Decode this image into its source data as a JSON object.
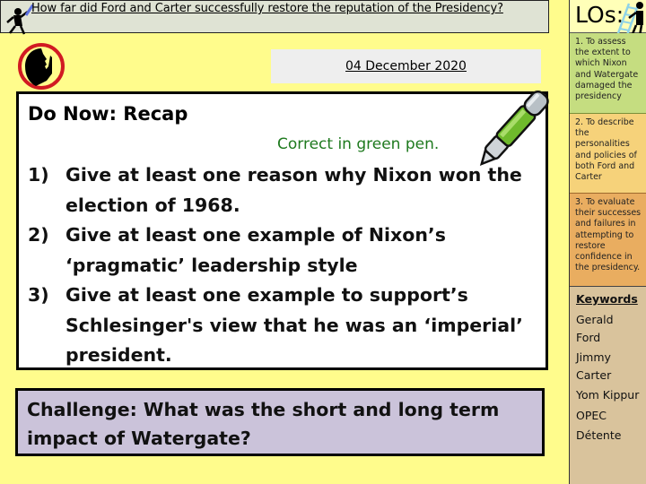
{
  "header": {
    "title": "How far did Ford and Carter successfully restore the reputation of the Presidency?",
    "icon": "running-figure-with-quill-icon"
  },
  "date": "04 December 2020",
  "do_now": {
    "icon": "silence-shush-icon",
    "heading": "Do Now: Recap",
    "note": "Correct in green pen.",
    "note_color": "#1f7a1f",
    "questions": [
      {
        "num": "1)",
        "text": "Give at least one reason why Nixon won the election of 1968."
      },
      {
        "num": "2)",
        "text": "Give at least one example of Nixon’s ‘pragmatic’ leadership style"
      },
      {
        "num": "3)",
        "text": "Give at least one example to support’s Schlesinger's view that he was an ‘imperial’ president."
      }
    ]
  },
  "challenge": {
    "text": "Challenge: What was the short and long term impact of Watergate?"
  },
  "sidebar": {
    "los_title": "LOs:",
    "objectives": [
      {
        "text": "1. To assess the extent to which Nixon and Watergate damaged the presidency",
        "color": "#c5dd80"
      },
      {
        "text": "2. To describe the personalities and policies of both Ford and Carter",
        "color": "#f6d27a"
      },
      {
        "text": "3. To evaluate their successes and failures in attempting to restore confidence in the presidency.",
        "color": "#e9ad60"
      }
    ],
    "keywords_title": "Keywords",
    "keywords": [
      "Gerald Ford",
      "Jimmy Carter",
      "Yom Kippur",
      "OPEC",
      "Détente"
    ]
  },
  "colors": {
    "background": "#fffc8c",
    "title_bar": "#dfe3d4",
    "challenge_bg": "#cbc3da",
    "keywords_bg": "#d9c39c"
  }
}
